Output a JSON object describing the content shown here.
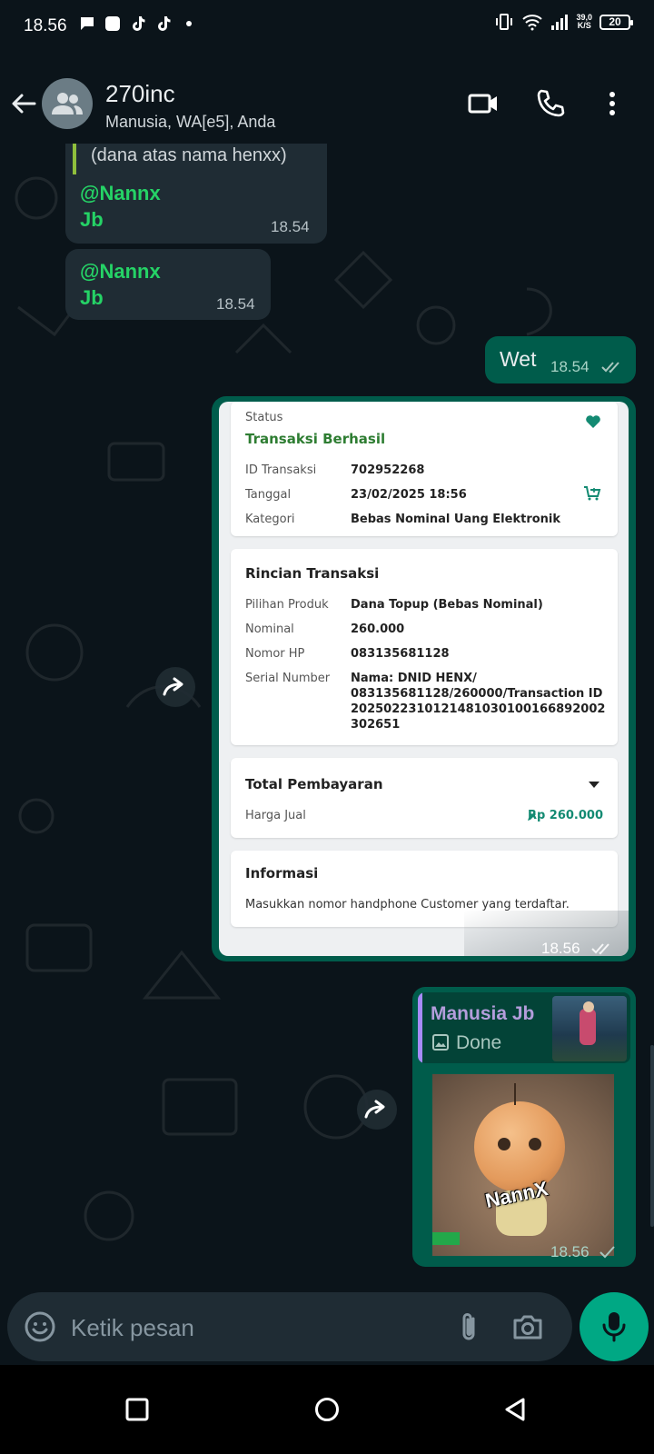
{
  "status_bar": {
    "time": "18.56",
    "speed_value": "39,0",
    "speed_unit": "K/S",
    "battery": "20"
  },
  "header": {
    "title": "270inc",
    "subtitle": "Manusia, WA[e5], Anda"
  },
  "messages": {
    "m1": {
      "quote": "(dana atas nama henxx)",
      "mention": "@Nannx",
      "text": "Jb",
      "time": "18.54"
    },
    "m2": {
      "mention": "@Nannx",
      "text": "Jb",
      "time": "18.54"
    },
    "m3": {
      "text": "Wet",
      "time": "18.54"
    },
    "receipt": {
      "time": "18.56",
      "status_label": "Status",
      "status_value": "Transaksi Berhasil",
      "id_label": "ID Transaksi",
      "id_value": "702952268",
      "date_label": "Tanggal",
      "date_value": "23/02/2025 18:56",
      "cat_label": "Kategori",
      "cat_value": "Bebas Nominal Uang Elektronik",
      "detail_title": "Rincian Transaksi",
      "product_label": "Pilihan Produk",
      "product_value": "Dana Topup (Bebas Nominal)",
      "nominal_label": "Nominal",
      "nominal_value": "260.000",
      "phone_label": "Nomor HP",
      "phone_value": "083135681128",
      "serial_label": "Serial Number",
      "serial_line1": "Nama: DNID HENX/",
      "serial_line2": "083135681128/260000/Transaction ID",
      "serial_line3": "2025022310121481030100166892002",
      "serial_line4": "302651",
      "total_title": "Total Pembayaran",
      "price_label": "Harga Jual",
      "price_value": "Rp 260.000",
      "info_title": "Informasi",
      "info_text": "Masukkan nomor handphone Customer yang terdaftar."
    },
    "reply": {
      "author": "Manusia Jb",
      "quoted": "Done",
      "sticker_text": "NannX",
      "time": "18.56"
    }
  },
  "input": {
    "placeholder": "Ketik pesan"
  },
  "colors": {
    "accent": "#00a884",
    "outgoing": "#005c4b",
    "incoming": "#1f2c34",
    "mention": "#25d366",
    "success": "#2e7d32",
    "teal": "#138a72"
  }
}
